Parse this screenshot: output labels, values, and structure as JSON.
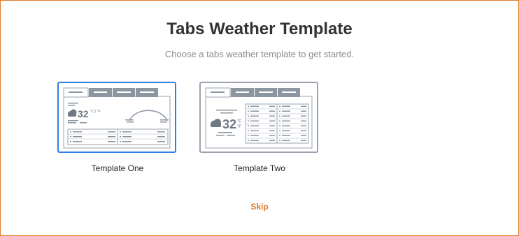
{
  "header": {
    "title": "Tabs Weather Template",
    "subtitle": "Choose a tabs weather template to get started."
  },
  "templates": [
    {
      "label": "Template One",
      "selected": true,
      "preview": {
        "temperature": "32",
        "units": "°C | °F"
      }
    },
    {
      "label": "Template Two",
      "selected": false,
      "preview": {
        "temperature": "32",
        "unit_c": "°C",
        "unit_f": "°F"
      }
    }
  ],
  "footer": {
    "skip_label": "Skip"
  },
  "colors": {
    "accent": "#e07b2a",
    "selected_border": "#2f80e3",
    "tab_gray": "#8c96a1",
    "line_gray": "#9aa3ad"
  },
  "icons": [
    "cloud-icon"
  ]
}
